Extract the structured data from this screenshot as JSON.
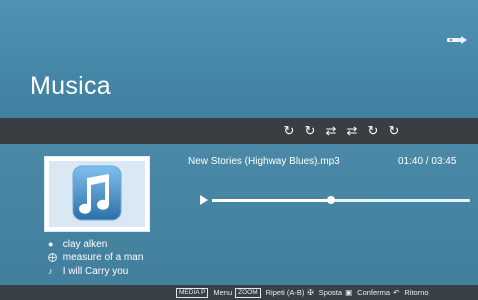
{
  "header": {
    "title": "Musica",
    "usb_icon": "usb-icon"
  },
  "mode_bar": {
    "icons": [
      {
        "name": "repeat-one-icon",
        "glyph": "↻"
      },
      {
        "name": "repeat-all-icon",
        "glyph": "↻"
      },
      {
        "name": "shuffle-icon",
        "glyph": "⇄"
      },
      {
        "name": "shuffle-repeat-icon",
        "glyph": "⇄"
      },
      {
        "name": "repeat-icon",
        "glyph": "↻"
      },
      {
        "name": "repeat-folder-icon",
        "glyph": "↻"
      }
    ]
  },
  "now_playing": {
    "track_name": "New Stories (Highway Blues).mp3",
    "time": "01:40 / 03:45",
    "progress_fraction": 0.46,
    "artist": "clay alken",
    "album": "measure of a man",
    "song": "I will Carry you"
  },
  "footer": {
    "key_media": "MEDIA P",
    "menu_label": "Menu",
    "key_zoom": "ZOOM",
    "repeat_label": "Ripeti (A-B)",
    "move_label": "Sposta",
    "confirm_label": "Conferma",
    "back_label": "Ritorno"
  },
  "colors": {
    "background": "#4a8aa8",
    "bar": "#3a3e42",
    "accent": "#ffffff"
  }
}
